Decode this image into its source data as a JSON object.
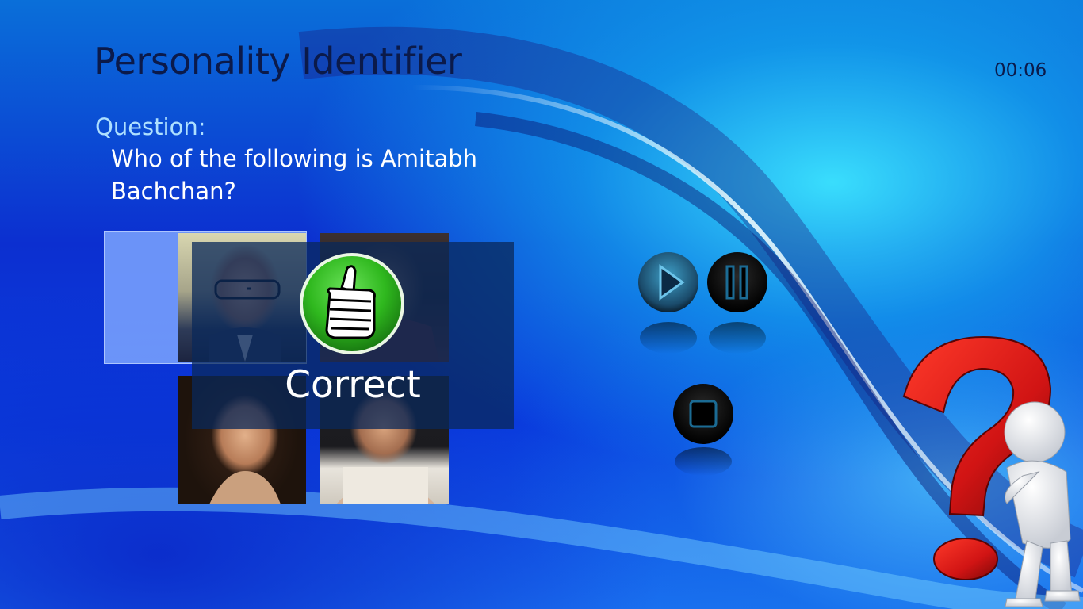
{
  "app": {
    "title": "Personality Identifier",
    "timer": "00:06"
  },
  "question": {
    "label": "Question:",
    "text": "Who of the following is Amitabh Bachchan?"
  },
  "options": [
    {
      "icon": "person-photo-amitabh",
      "selected": true
    },
    {
      "icon": "person-photo-man"
    },
    {
      "icon": "person-photo-woman"
    },
    {
      "icon": "person-photo-woman"
    }
  ],
  "result": {
    "text": "Correct",
    "icon": "thumbs-up-icon",
    "color": "#2fb81e"
  },
  "controls": [
    {
      "icon": "play-icon"
    },
    {
      "icon": "pause-icon"
    },
    {
      "icon": "stop-icon"
    }
  ],
  "theme": {
    "accent": "#1060e0",
    "title_color": "#0b1a4a",
    "label_color": "#aee0ff",
    "question_mark_color": "#d11414"
  }
}
